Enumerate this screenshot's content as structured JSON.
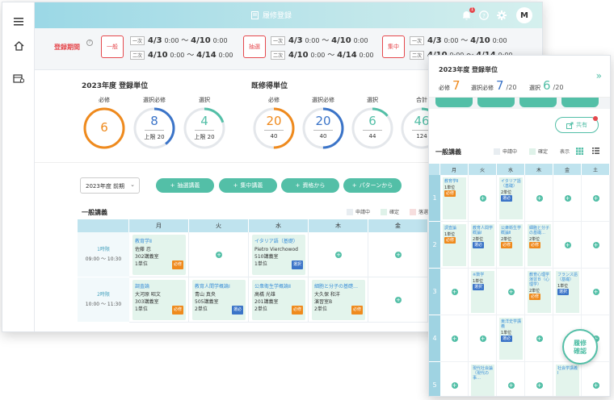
{
  "colors": {
    "accent": "#53bfa7",
    "required": "#ef8a1d",
    "elective": "#3b74c8",
    "alert": "#e5484d"
  },
  "topbar": {
    "title": "履修登録",
    "notif_count": "1",
    "avatar": "M",
    "icons": [
      "menu-icon",
      "home-icon",
      "calendar-icon",
      "bell-icon",
      "help-icon",
      "gear-icon"
    ]
  },
  "period": {
    "label": "登録期間",
    "groups": [
      {
        "type": "一般",
        "r1_tag": "一次",
        "r1_from": "4/3",
        "r1_from_t": "0:00",
        "r1_to": "4/10",
        "r1_to_t": "0:00",
        "r2_tag": "二次",
        "r2_from": "4/10",
        "r2_from_t": "0:00",
        "r2_to": "4/14",
        "r2_to_t": "0:00"
      },
      {
        "type": "抽選",
        "r1_tag": "一次",
        "r1_from": "4/3",
        "r1_from_t": "0:00",
        "r1_to": "4/10",
        "r1_to_t": "0:00",
        "r2_tag": "二次",
        "r2_from": "4/10",
        "r2_from_t": "0:00",
        "r2_to": "4/14",
        "r2_to_t": "0:00"
      },
      {
        "type": "集中",
        "r1_tag": "一次",
        "r1_from": "4/3",
        "r1_from_t": "0:00",
        "r1_to": "4/10",
        "r1_to_t": "0:00",
        "r2_tag": "二次",
        "r2_from": "4/10",
        "r2_from_t": "0:00",
        "r2_to": "4/14",
        "r2_to_t": "0:00"
      }
    ]
  },
  "credits": {
    "title": "2023年度 登録単位",
    "rings": [
      {
        "label": "必修",
        "value": "6",
        "sub": "",
        "color": "#ef8a1d",
        "fraction": 1.0
      },
      {
        "label": "選択必修",
        "value": "8",
        "sub": "上限 20",
        "color": "#3b74c8",
        "fraction": 0.4
      },
      {
        "label": "選択",
        "value": "4",
        "sub": "上限 20",
        "color": "#53bfa7",
        "fraction": 0.2
      }
    ],
    "earned_title": "既修得単位",
    "earned": [
      {
        "label": "必修",
        "value": "20",
        "sub": "40",
        "color": "#ef8a1d",
        "fraction": 0.5
      },
      {
        "label": "選択必修",
        "value": "20",
        "sub": "40",
        "color": "#3b74c8",
        "fraction": 0.5
      },
      {
        "label": "選択",
        "value": "6",
        "sub": "44",
        "color": "#53bfa7",
        "fraction": 0.14
      },
      {
        "label": "合計",
        "value": "46",
        "sub": "124",
        "color": "#53bfa7",
        "fraction": 0.37
      }
    ]
  },
  "filters": {
    "term": "2023年度 前期",
    "buttons": [
      "抽選講義",
      "集中講義",
      "資格から",
      "パターンから"
    ]
  },
  "timetable": {
    "title": "一般講義",
    "legend": [
      "申請中",
      "確定",
      "落選／…"
    ],
    "days": [
      "月",
      "火",
      "水",
      "木",
      "金"
    ],
    "periods": [
      {
        "name": "1時限",
        "time": "09:00 ～ 10:30"
      },
      {
        "name": "2時限",
        "time": "10:00 ～ 11:30"
      }
    ],
    "courses": [
      {
        "name": "教育学Ⅱ",
        "teacher": "佐藤 忍",
        "room": "302講義室",
        "unit": "1単位",
        "kind": "必修"
      },
      {
        "name": "イタリア語（基礎）",
        "teacher": "Pietro Vierchowod",
        "room": "510講義室",
        "unit": "1単位",
        "kind": "選択"
      },
      {
        "name": "調査論",
        "teacher": "大河原 昭文",
        "room": "303講義室",
        "unit": "1単位",
        "kind": "必修"
      },
      {
        "name": "教育人間学概論Ⅰ",
        "teacher": "青山 真央",
        "room": "505講義室",
        "unit": "2単位",
        "kind": "選必"
      },
      {
        "name": "公衆衛生学概論Ⅱ",
        "teacher": "高橋 光雄",
        "room": "201講義室",
        "unit": "2単位",
        "kind": "必修"
      },
      {
        "name": "細胞と分子の基礎…",
        "teacher": "大久保 和洋",
        "room": "演習室B",
        "unit": "2単位",
        "kind": "必修"
      }
    ]
  },
  "mobile": {
    "title": "2023年度 登録単位",
    "stats": [
      {
        "label": "必修",
        "value": "7",
        "den": "",
        "color": "#ef8a1d"
      },
      {
        "label": "選択必修",
        "value": "7",
        "den": "/20",
        "color": "#3b74c8"
      },
      {
        "label": "選択",
        "value": "6",
        "den": "/20",
        "color": "#53bfa7"
      }
    ],
    "share": "共有",
    "section": "一般講義",
    "legend": [
      "申請中",
      "確定"
    ],
    "display_label": "表示",
    "days": [
      "月",
      "火",
      "水",
      "木",
      "金",
      "土"
    ],
    "periods": [
      "1",
      "2",
      "3",
      "4",
      "5"
    ],
    "courses": [
      {
        "name": "教育学Ⅱ",
        "unit": "1単位",
        "kind": "必修"
      },
      {
        "name": "イタリア語（基礎）",
        "unit": "2単位",
        "kind": "選必"
      },
      {
        "name": "調査論",
        "unit": "1単位",
        "kind": "必修"
      },
      {
        "name": "教育人間学概論Ⅰ",
        "unit": "2単位",
        "kind": "選必"
      },
      {
        "name": "公衆衛生学概論Ⅱ",
        "unit": "2単位",
        "kind": "必修"
      },
      {
        "name": "細胞と分子の基礎…",
        "unit": "2単位",
        "kind": "必修"
      },
      {
        "name": "※数学",
        "unit": "1単位",
        "kind": "選択"
      },
      {
        "name": "教育心理学演習Ｂ（心理学）",
        "unit": "2単位",
        "kind": "必修"
      },
      {
        "name": "フランス語（基礎）",
        "unit": "1単位",
        "kind": "選択"
      },
      {
        "name": "東洋史学講義",
        "unit": "1単位",
        "kind": "選必"
      },
      {
        "name": "現代社会論（現代の事…",
        "unit": "",
        "kind": ""
      },
      {
        "name": "社会学講義Ⅰ",
        "unit": "",
        "kind": ""
      }
    ],
    "fab": [
      "履修",
      "確認"
    ]
  }
}
